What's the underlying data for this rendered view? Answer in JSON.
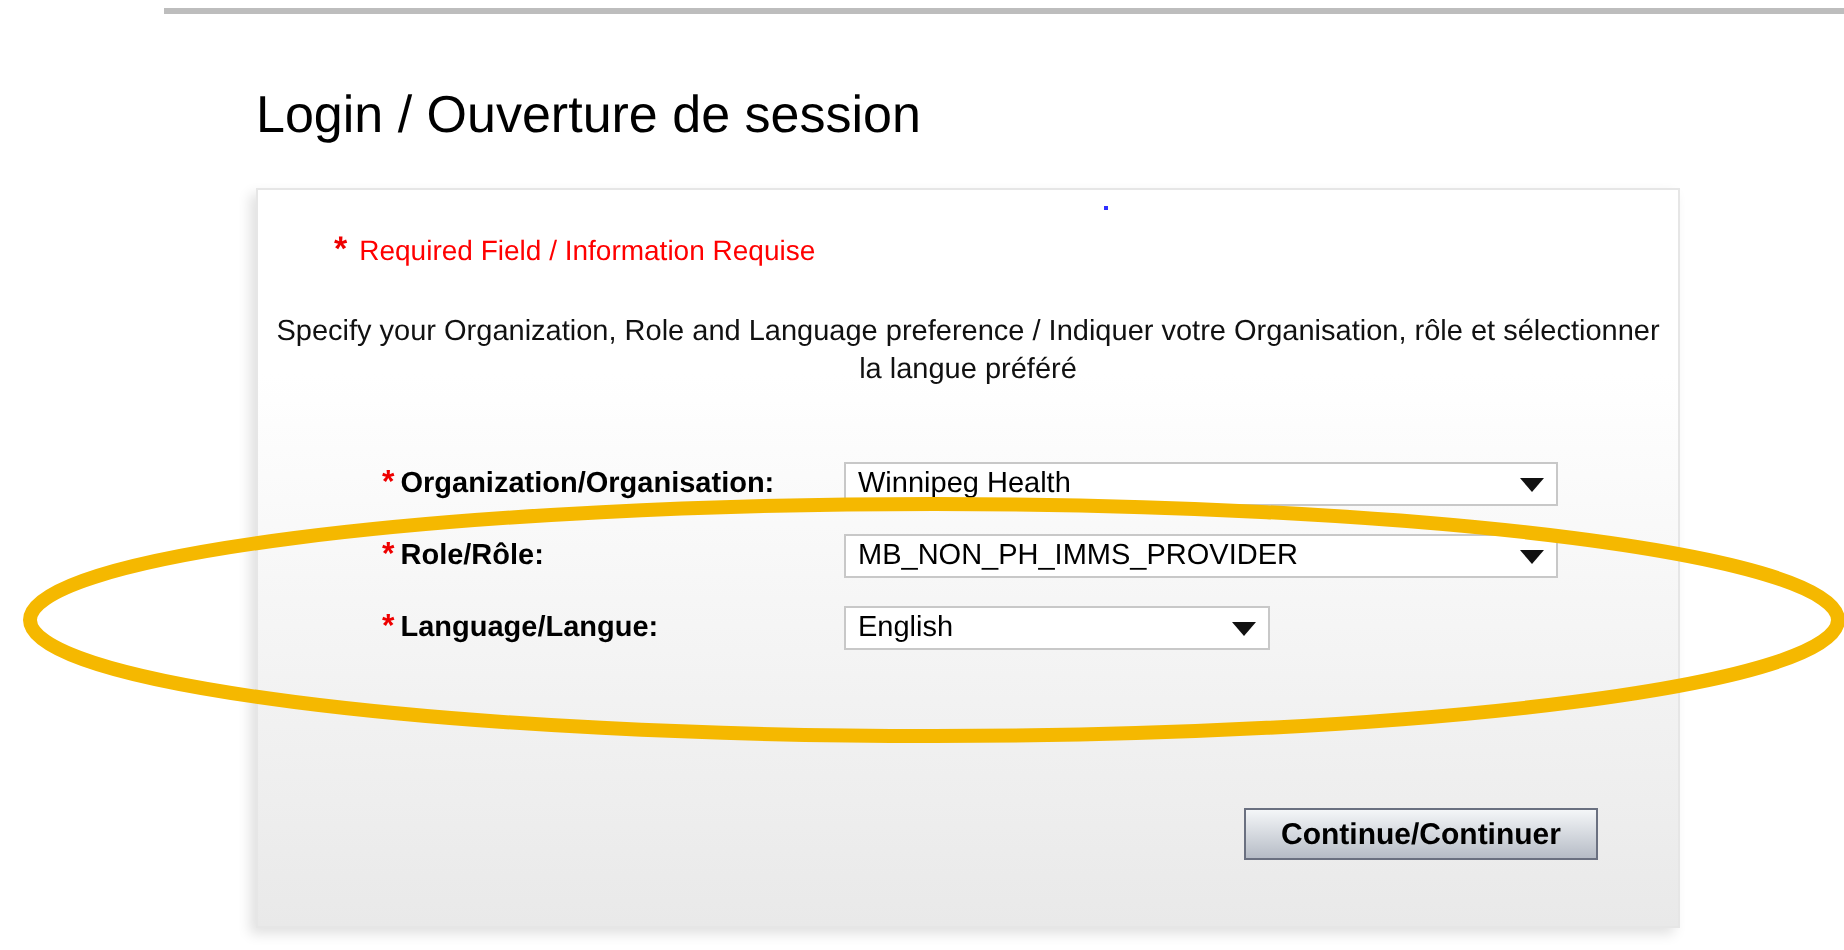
{
  "title": "Login / Ouverture de session",
  "required_note": {
    "mark": "*",
    "text": "Required Field / Information Requise"
  },
  "instructions": "Specify your Organization, Role and Language preference / Indiquer votre Organisation, rôle et sélectionner la langue préféré",
  "fields": [
    {
      "label": "Organization/Organisation:",
      "value": "Winnipeg Health",
      "required": true,
      "kind": "wide"
    },
    {
      "label": "Role/Rôle:",
      "value": "MB_NON_PH_IMMS_PROVIDER",
      "required": true,
      "kind": "wide"
    },
    {
      "label": "Language/Langue:",
      "value": "English",
      "required": true,
      "kind": "narrow"
    }
  ],
  "button": "Continue/Continuer"
}
